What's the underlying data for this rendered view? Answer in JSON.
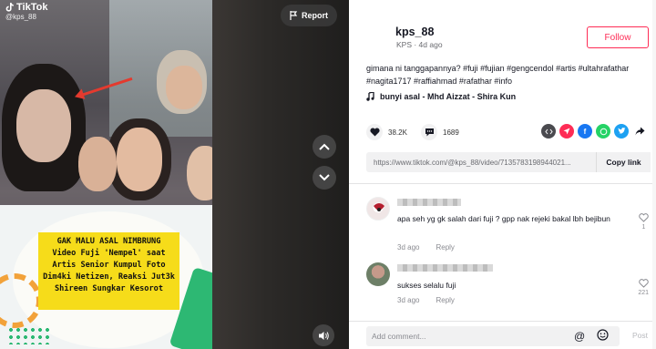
{
  "video": {
    "watermark_brand": "TikTok",
    "watermark_user": "@kps_88",
    "caption_lines": [
      "GAK MALU ASAL NIMBRUNG",
      "Video Fuji 'Nempel' saat",
      "Artis Senior Kumpul Foto",
      "Dim4ki Netizen, Reaksi Jut3k",
      "Shireen Sungkar Kesorot"
    ],
    "report_label": "Report"
  },
  "author": {
    "username": "kps_88",
    "info": "KPS · 4d ago",
    "follow_label": "Follow"
  },
  "post": {
    "description": "gimana ni tanggapannya? #fuji #fujian #gengcendol #artis #ultahrafathar #nagita1717 #raffiahmad #rafathar #info",
    "music": "bunyi asal - Mhd Aizzat - Shira Kun",
    "likes": "38.2K",
    "comments": "1689",
    "link": "https://www.tiktok.com/@kps_88/video/7135783198944021...",
    "copy_link_label": "Copy link"
  },
  "comments": [
    {
      "text": "apa seh yg gk salah dari fuji ? gpp nak rejeki bakal lbh bejibun",
      "time": "3d ago",
      "reply": "Reply",
      "likes": "1"
    },
    {
      "text": "sukses selalu fuji",
      "time": "3d ago",
      "reply": "Reply",
      "likes": "221"
    }
  ],
  "composer": {
    "placeholder": "Add comment...",
    "post_label": "Post"
  },
  "colors": {
    "accent": "#fe2c55",
    "caption_bg": "#f6dc1a"
  }
}
